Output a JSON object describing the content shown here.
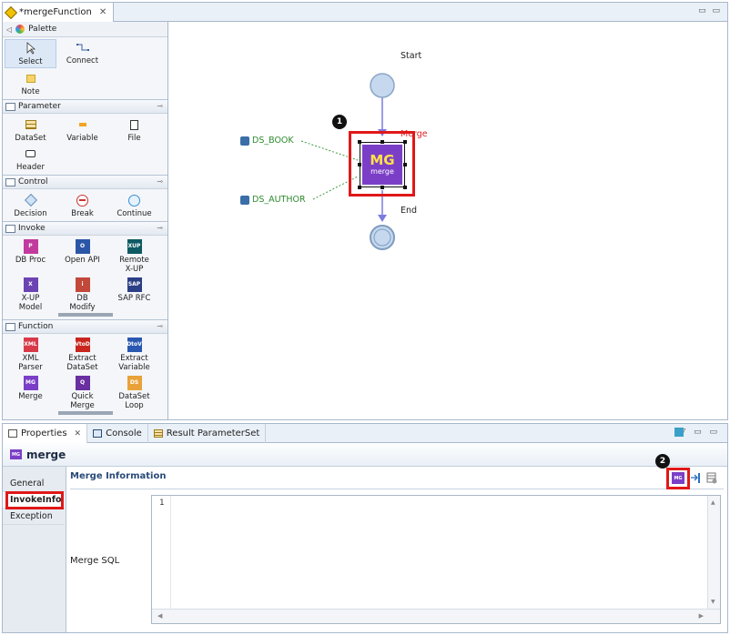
{
  "editor": {
    "tab_title": "*mergeFunction",
    "tab_close": "✕",
    "window_controls": "▭ ▭"
  },
  "palette": {
    "header": "Palette",
    "tools": [
      {
        "label": "Select",
        "icon": "arrow-icon"
      },
      {
        "label": "Connect",
        "icon": "connect-icon"
      },
      {
        "label": "Note",
        "icon": "note-icon"
      }
    ],
    "sections": {
      "parameter": {
        "title": "Parameter",
        "items": [
          "DataSet",
          "Variable",
          "File",
          "Header"
        ]
      },
      "control": {
        "title": "Control",
        "items": [
          "Decision",
          "Break",
          "Continue"
        ]
      },
      "invoke": {
        "title": "Invoke",
        "items": [
          "DB Proc",
          "Open API",
          "Remote X-UP",
          "X-UP Model",
          "DB Modify",
          "SAP RFC"
        ]
      },
      "function": {
        "title": "Function",
        "items": [
          "XML Parser",
          "Extract DataSet",
          "Extract Variable",
          "Merge",
          "Quick Merge",
          "DataSet Loop"
        ]
      }
    }
  },
  "canvas": {
    "start_label": "Start",
    "end_label": "End",
    "merge_label": "Merge",
    "ds1": "DS_BOOK",
    "ds2": "DS_AUTHOR",
    "node_title": "MG",
    "node_sub": "merge",
    "badge1": "1",
    "badge2": "2"
  },
  "properties": {
    "tabs": [
      "Properties",
      "Console",
      "Result ParameterSet"
    ],
    "title": "merge",
    "side_tabs": [
      "General",
      "InvokeInfo",
      "Exception"
    ],
    "section_title": "Merge Information",
    "field_label": "Merge SQL",
    "line_number": "1"
  },
  "colors": {
    "merge_purple": "#7b3fc7",
    "highlight_red": "#e01818",
    "connector_blue": "#7b7be0"
  }
}
